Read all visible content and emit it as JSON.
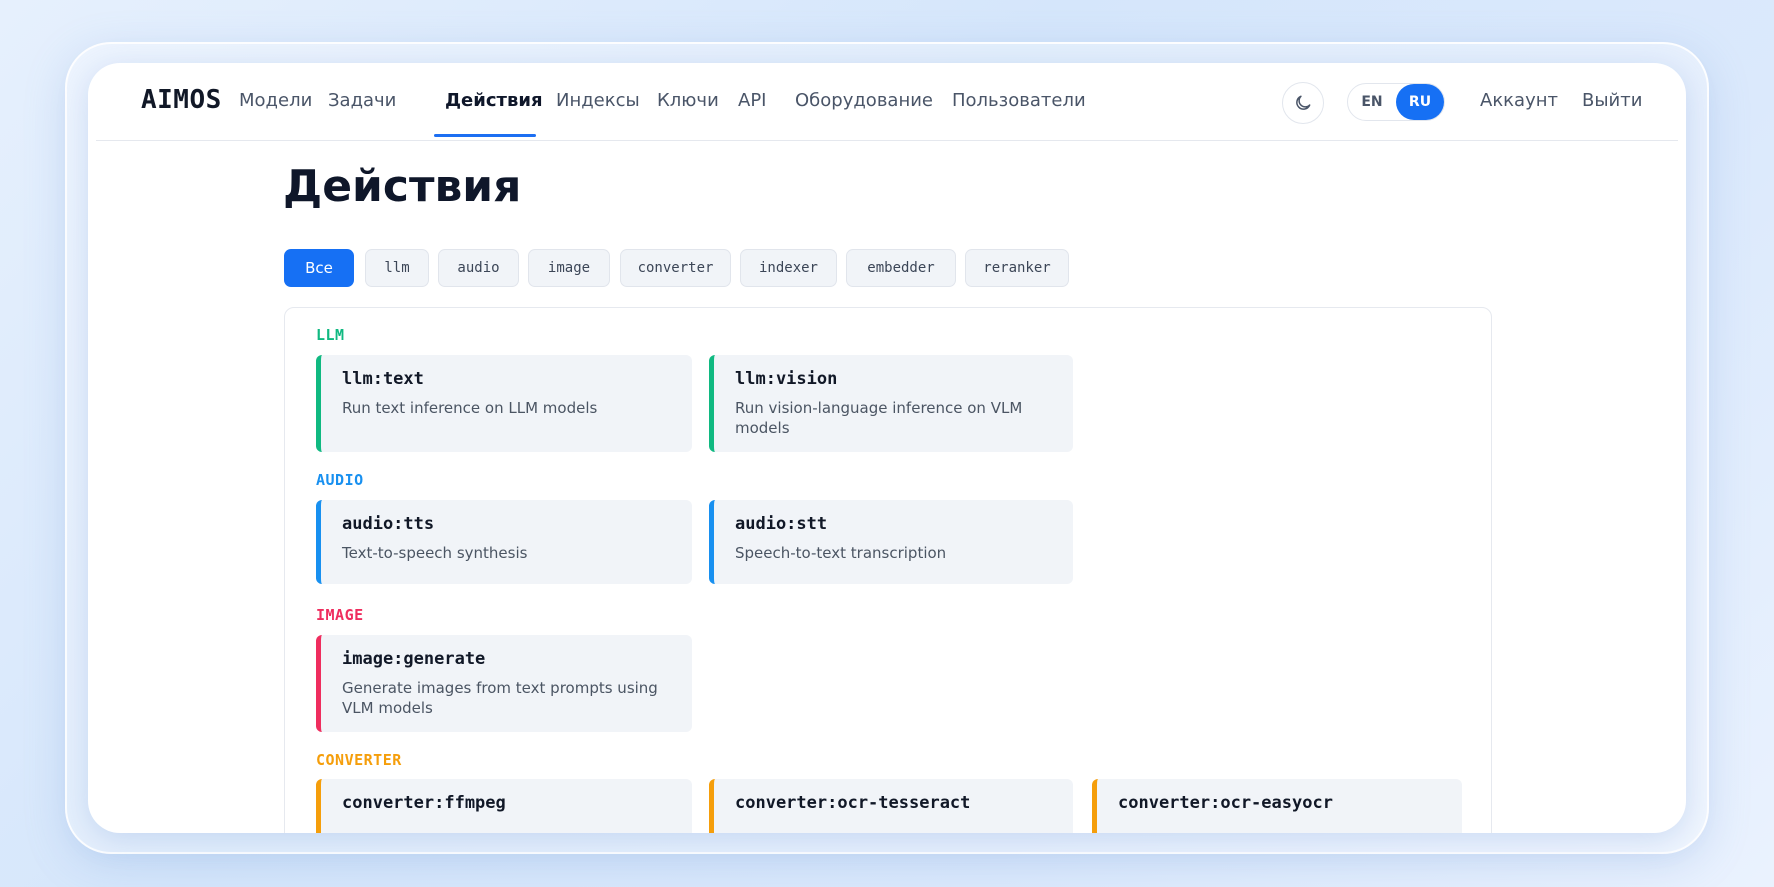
{
  "nav": {
    "logo": "AIMOS",
    "items": [
      {
        "label": "Модели"
      },
      {
        "label": "Задачи"
      },
      {
        "label": "Действия"
      },
      {
        "label": "Индексы"
      },
      {
        "label": "Ключи"
      },
      {
        "label": "API"
      },
      {
        "label": "Оборудование"
      },
      {
        "label": "Пользователи"
      }
    ],
    "active_index": 2,
    "lang_en": "EN",
    "lang_ru": "RU",
    "lang_selected": "RU",
    "account": "Аккаунт",
    "logout": "Выйти",
    "theme_icon": "moon-icon"
  },
  "page": {
    "title": "Действия"
  },
  "filters": {
    "items": [
      "Все",
      "llm",
      "audio",
      "image",
      "converter",
      "indexer",
      "embedder",
      "reranker"
    ],
    "selected": "Все"
  },
  "groups": [
    {
      "title": "LLM",
      "color": "#10b981",
      "cards": [
        {
          "title": "llm:text",
          "desc": "Run text inference on LLM models"
        },
        {
          "title": "llm:vision",
          "desc": "Run vision-language inference on VLM models"
        }
      ]
    },
    {
      "title": "AUDIO",
      "color": "#1890f0",
      "cards": [
        {
          "title": "audio:tts",
          "desc": "Text-to-speech synthesis"
        },
        {
          "title": "audio:stt",
          "desc": "Speech-to-text transcription"
        }
      ]
    },
    {
      "title": "IMAGE",
      "color": "#ef2d5e",
      "cards": [
        {
          "title": "image:generate",
          "desc": "Generate images from text prompts using VLM models"
        }
      ]
    },
    {
      "title": "CONVERTER",
      "color": "#f59e0b",
      "cards": [
        {
          "title": "converter:ffmpeg",
          "desc": ""
        },
        {
          "title": "converter:ocr-tesseract",
          "desc": ""
        },
        {
          "title": "converter:ocr-easyocr",
          "desc": ""
        }
      ]
    }
  ]
}
